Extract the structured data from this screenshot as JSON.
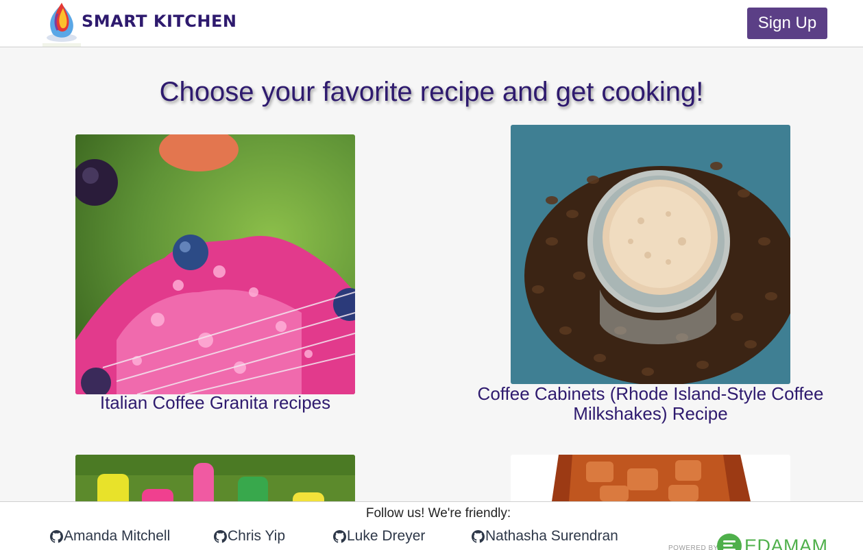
{
  "header": {
    "brand": "SMART KITCHEN",
    "signup_label": "Sign Up"
  },
  "main": {
    "headline": "Choose your favorite recipe and get cooking!",
    "recipes": [
      {
        "title": "Italian Coffee Granita recipes"
      },
      {
        "title": "Coffee Cabinets (Rhode Island-Style Coffee Milkshakes) Recipe"
      }
    ]
  },
  "footer": {
    "follow_text": "Follow us! We're friendly:",
    "team": [
      {
        "name": "Amanda Mitchell"
      },
      {
        "name": "Chris Yip"
      },
      {
        "name": "Luke Dreyer"
      },
      {
        "name": "Nathasha Surendran"
      }
    ],
    "powered_by": "POWERED BY",
    "partner": "EDAMAM"
  },
  "colors": {
    "brand": "#2e1a6e",
    "button": "#5b3f86",
    "background": "#f6f6f6",
    "partner_green": "#4fb04b"
  },
  "icons": [
    "flame-logo-icon",
    "github-icon",
    "edamam-logo-icon"
  ]
}
